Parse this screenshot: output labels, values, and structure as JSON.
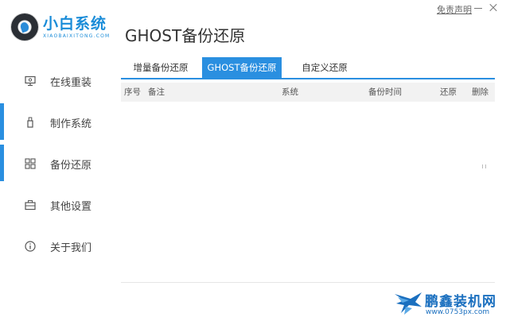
{
  "app": {
    "logo_title": "小白系统",
    "logo_subtitle": "XIAOBAIXITONG.COM",
    "page_title": "GHOST备份还原",
    "disclaimer": "免责声明"
  },
  "sidebar": {
    "items": [
      {
        "label": "在线重装",
        "icon": "monitor-icon",
        "active": false
      },
      {
        "label": "制作系统",
        "icon": "usb-icon",
        "active": true
      },
      {
        "label": "备份还原",
        "icon": "grid-icon",
        "active": true
      },
      {
        "label": "其他设置",
        "icon": "briefcase-icon",
        "active": false
      },
      {
        "label": "关于我们",
        "icon": "info-icon",
        "active": false
      }
    ]
  },
  "tabs": [
    {
      "label": "增量备份还原",
      "active": false
    },
    {
      "label": "GHOST备份还原",
      "active": true
    },
    {
      "label": "自定义还原",
      "active": false
    }
  ],
  "table": {
    "columns": [
      "序号",
      "备注",
      "系统",
      "备份时间",
      "还原",
      "删除"
    ],
    "rows": []
  },
  "watermark": {
    "text": "鹏鑫装机网",
    "url": "www.0753px.com"
  },
  "colors": {
    "accent": "#2a8fe0",
    "brand": "#1a8cd8"
  }
}
